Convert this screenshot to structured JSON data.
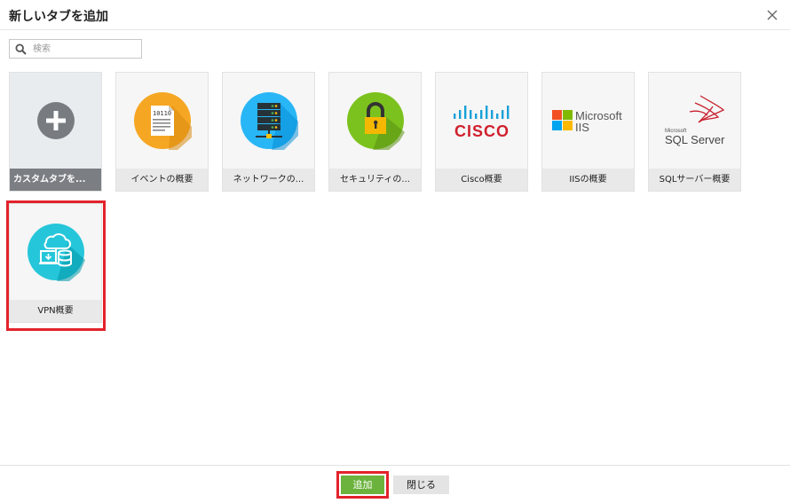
{
  "dialog": {
    "title": "新しいタブを追加"
  },
  "search": {
    "placeholder": "検索",
    "value": ""
  },
  "tiles": [
    {
      "label": "カスタムタブを...",
      "icon": "plus-icon"
    },
    {
      "label": "イベントの概要",
      "icon": "event-log-icon",
      "icon_text": "10110"
    },
    {
      "label": "ネットワークの...",
      "icon": "server-network-icon"
    },
    {
      "label": "セキュリティの...",
      "icon": "padlock-icon"
    },
    {
      "label": "Cisco概要",
      "icon": "cisco-logo",
      "logo_text": "CISCO"
    },
    {
      "label": "IISの概要",
      "icon": "microsoft-iis-logo",
      "logo_text": [
        "Microsoft",
        "IIS"
      ]
    },
    {
      "label": "SQLサーバー概要",
      "icon": "sql-server-logo",
      "logo_text": [
        "Microsoft",
        "SQL Server"
      ]
    },
    {
      "label": "VPN概要",
      "icon": "vpn-cloud-icon"
    }
  ],
  "footer": {
    "add_label": "追加",
    "close_label": "閉じる"
  },
  "colors": {
    "accent_green": "#6cb33e",
    "highlight_red": "#e3222b",
    "event_orange": "#f5a623",
    "network_blue": "#29b6f6",
    "security_green": "#7cc21e",
    "vpn_teal": "#26c6da",
    "cisco_red": "#d0202e",
    "cisco_blue": "#1ba0d7"
  }
}
